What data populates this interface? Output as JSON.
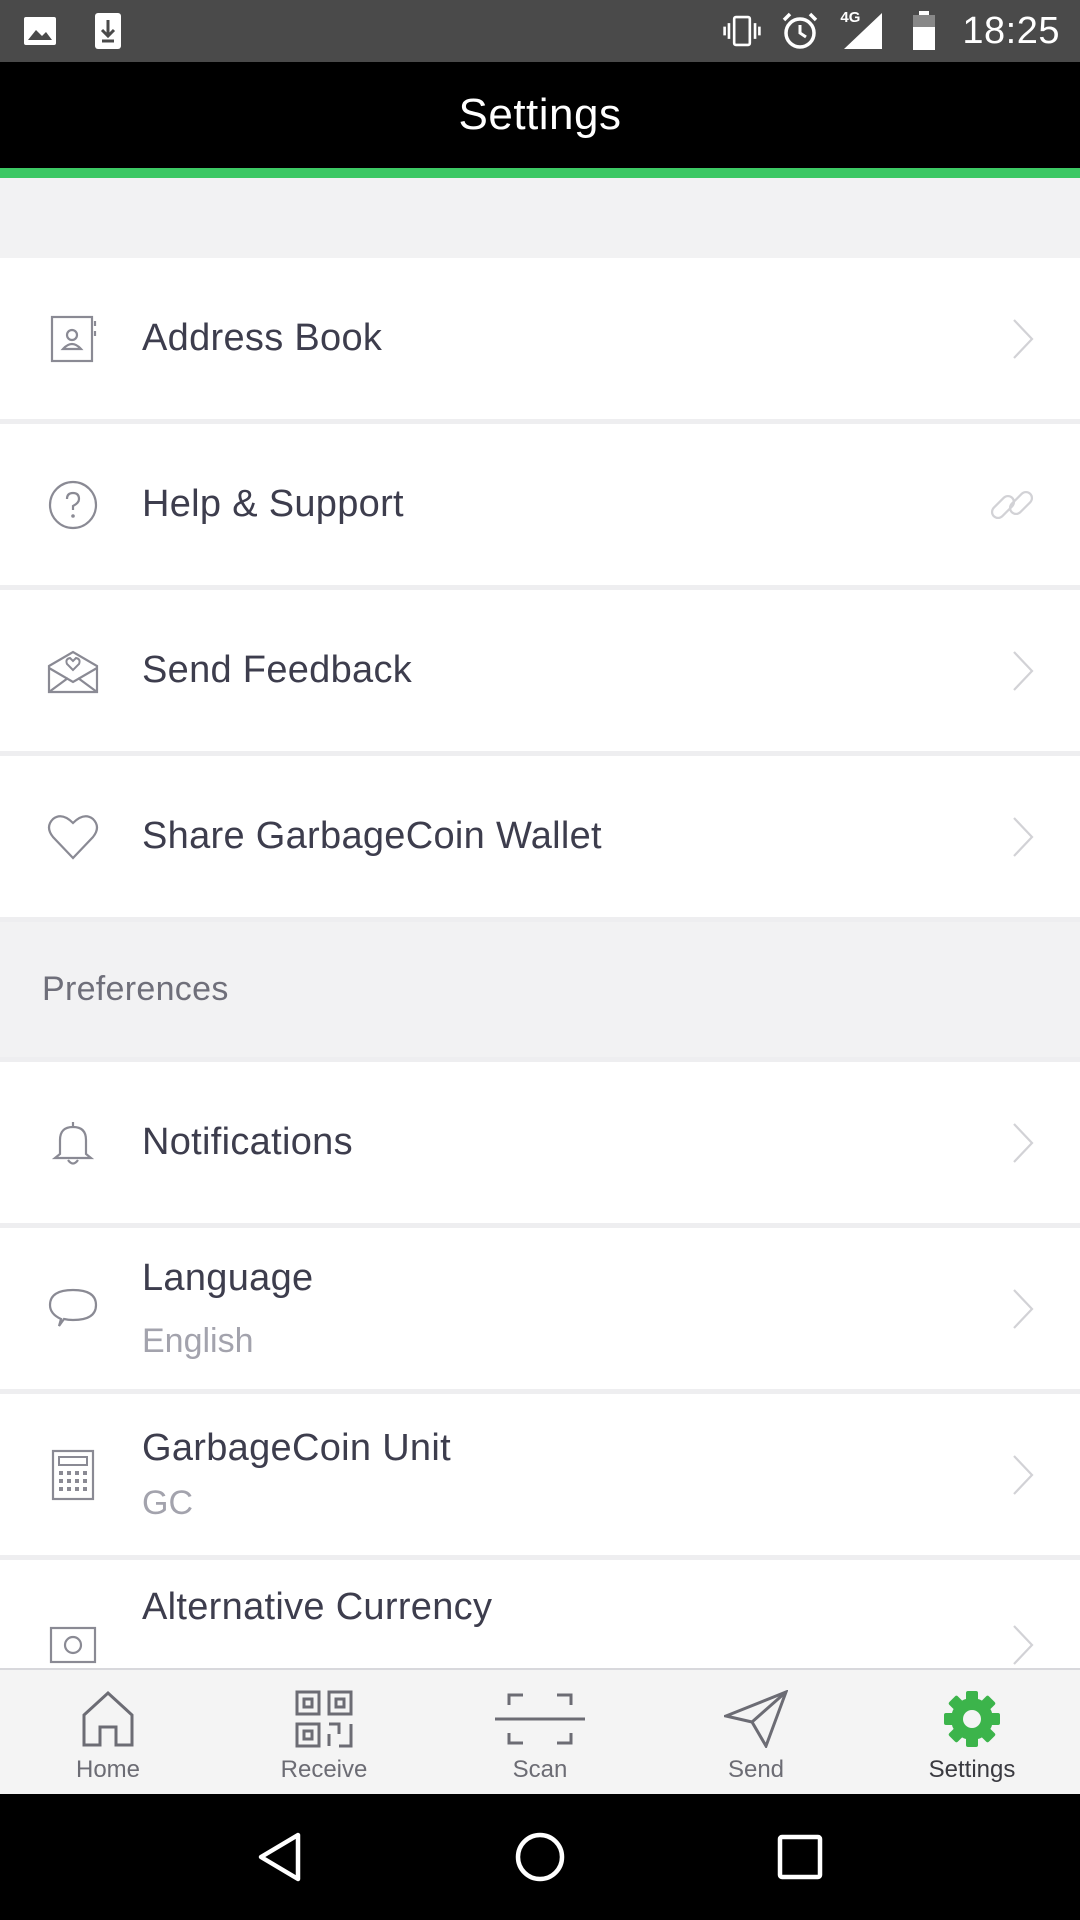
{
  "status_bar": {
    "time": "18:25",
    "network": "4G",
    "left_icons": [
      "image-icon",
      "download-icon"
    ],
    "right_icons": [
      "vibrate-icon",
      "alarm-icon",
      "signal-icon",
      "battery-icon"
    ]
  },
  "header": {
    "title": "Settings",
    "accent_color": "#3cc864"
  },
  "settings": {
    "items": [
      {
        "label": "Address Book",
        "icon": "address-book-icon",
        "trailing": "chevron"
      },
      {
        "label": "Help & Support",
        "icon": "help-icon",
        "trailing": "link"
      },
      {
        "label": "Send Feedback",
        "icon": "feedback-envelope-icon",
        "trailing": "chevron"
      },
      {
        "label": "Share GarbageCoin Wallet",
        "icon": "heart-icon",
        "trailing": "chevron"
      }
    ],
    "preferences_title": "Preferences",
    "preferences": [
      {
        "label": "Notifications",
        "icon": "bell-icon",
        "trailing": "chevron"
      },
      {
        "label": "Language",
        "sublabel": "English",
        "icon": "chat-bubble-icon",
        "trailing": "chevron"
      },
      {
        "label": "GarbageCoin Unit",
        "sublabel": "GC",
        "icon": "calculator-icon",
        "trailing": "chevron"
      },
      {
        "label": "Alternative Currency",
        "icon": "currency-icon",
        "trailing": "chevron"
      }
    ]
  },
  "bottom_nav": {
    "items": [
      {
        "label": "Home",
        "icon": "home-icon"
      },
      {
        "label": "Receive",
        "icon": "qr-code-icon"
      },
      {
        "label": "Scan",
        "icon": "scan-icon"
      },
      {
        "label": "Send",
        "icon": "paper-plane-icon"
      },
      {
        "label": "Settings",
        "icon": "gear-icon",
        "active": true
      }
    ],
    "active_color": "#3cb44b"
  },
  "android_nav": {
    "buttons": [
      "back-icon",
      "home-circle-icon",
      "recents-icon"
    ]
  }
}
